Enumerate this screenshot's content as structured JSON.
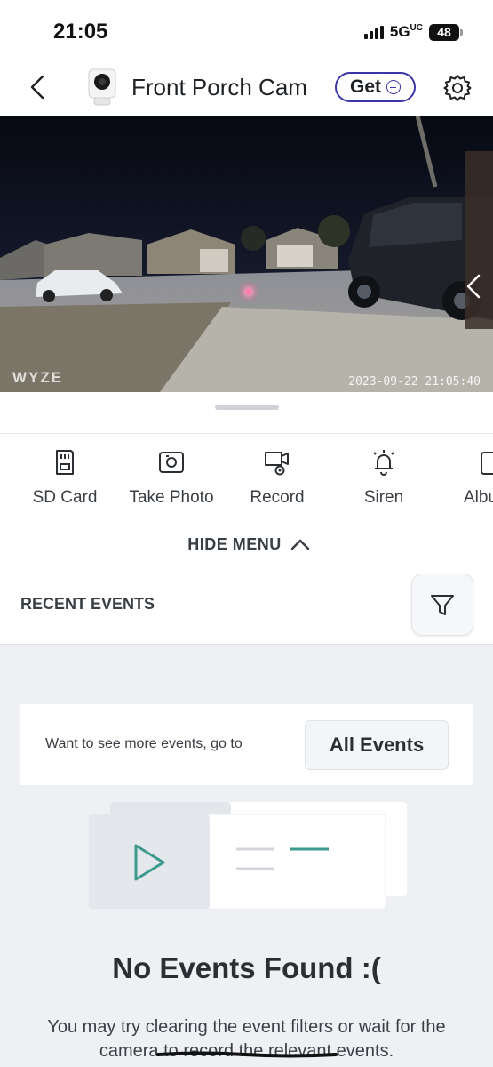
{
  "status_bar": {
    "time": "21:05",
    "network": "5G",
    "network_suffix": "UC",
    "battery": "48"
  },
  "header": {
    "back_icon": "chevron-left-icon",
    "camera_name": "Front Porch Cam",
    "get_label": "Get",
    "settings_icon": "gear-icon"
  },
  "video": {
    "watermark": "WYZE",
    "timestamp": "2023-09-22 21:05:40"
  },
  "actions": [
    {
      "label": "SD Card",
      "icon": "sd-card-icon"
    },
    {
      "label": "Take Photo",
      "icon": "camera-icon"
    },
    {
      "label": "Record",
      "icon": "record-icon"
    },
    {
      "label": "Siren",
      "icon": "siren-icon"
    },
    {
      "label": "Album",
      "icon": "album-icon"
    }
  ],
  "menu": {
    "hide_label": "HIDE MENU"
  },
  "events": {
    "title": "RECENT EVENTS",
    "more_text": "Want to see more events, go to",
    "all_events_label": "All Events",
    "empty_title": "No Events Found :(",
    "empty_desc": "You may try clearing the event filters or wait for the camera to record the relevant events."
  },
  "colors": {
    "accent": "#3b35a8",
    "teal": "#3e9a8c",
    "background": "#eef0f3"
  }
}
